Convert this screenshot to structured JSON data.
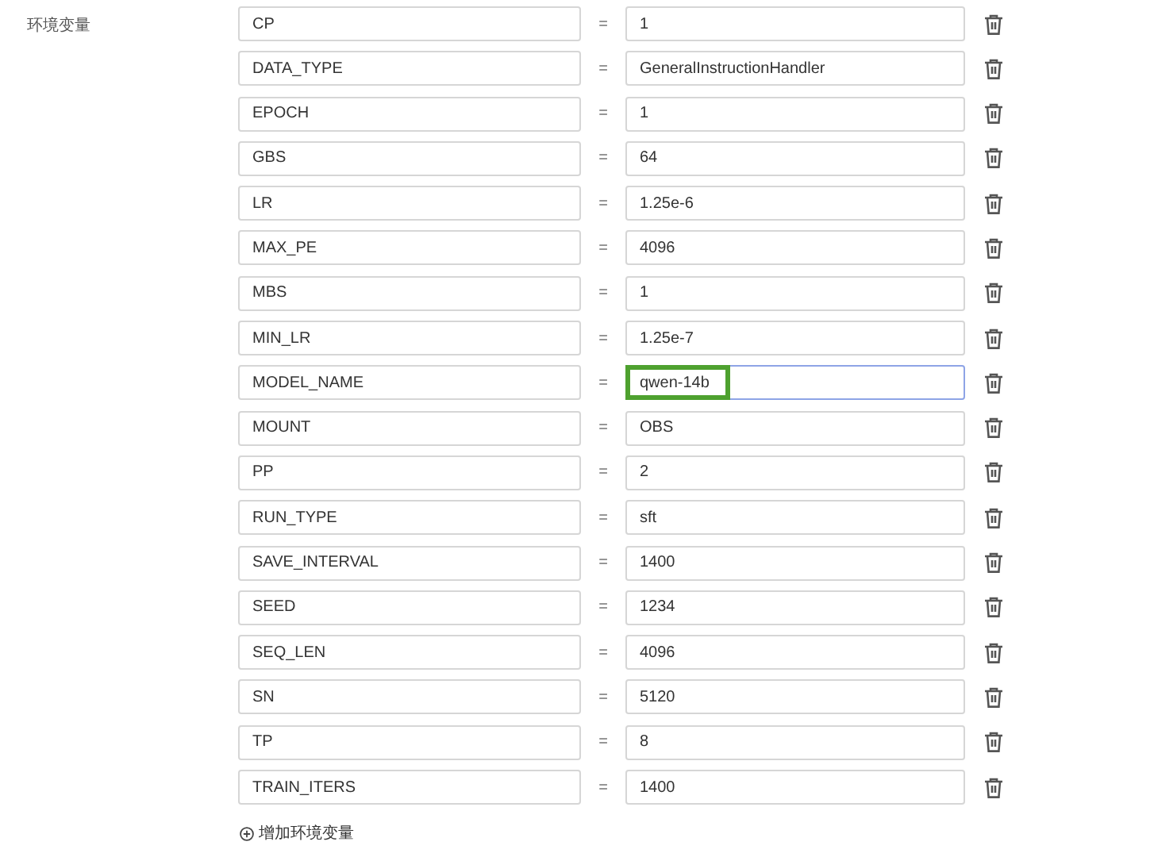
{
  "section_label": "环境变量",
  "variables": [
    {
      "key": "CP",
      "value": "1",
      "focused": false,
      "highlighted": false
    },
    {
      "key": "DATA_TYPE",
      "value": "GeneralInstructionHandler",
      "focused": false,
      "highlighted": false
    },
    {
      "key": "EPOCH",
      "value": "1",
      "focused": false,
      "highlighted": false
    },
    {
      "key": "GBS",
      "value": "64",
      "focused": false,
      "highlighted": false
    },
    {
      "key": "LR",
      "value": "1.25e-6",
      "focused": false,
      "highlighted": false
    },
    {
      "key": "MAX_PE",
      "value": "4096",
      "focused": false,
      "highlighted": false
    },
    {
      "key": "MBS",
      "value": "1",
      "focused": false,
      "highlighted": false
    },
    {
      "key": "MIN_LR",
      "value": "1.25e-7",
      "focused": false,
      "highlighted": false
    },
    {
      "key": "MODEL_NAME",
      "value": "qwen-14b",
      "focused": true,
      "highlighted": true
    },
    {
      "key": "MOUNT",
      "value": "OBS",
      "focused": false,
      "highlighted": false
    },
    {
      "key": "PP",
      "value": "2",
      "focused": false,
      "highlighted": false
    },
    {
      "key": "RUN_TYPE",
      "value": "sft",
      "focused": false,
      "highlighted": false
    },
    {
      "key": "SAVE_INTERVAL",
      "value": "1400",
      "focused": false,
      "highlighted": false
    },
    {
      "key": "SEED",
      "value": "1234",
      "focused": false,
      "highlighted": false
    },
    {
      "key": "SEQ_LEN",
      "value": "4096",
      "focused": false,
      "highlighted": false
    },
    {
      "key": "SN",
      "value": "5120",
      "focused": false,
      "highlighted": false
    },
    {
      "key": "TP",
      "value": "8",
      "focused": false,
      "highlighted": false
    },
    {
      "key": "TRAIN_ITERS",
      "value": "1400",
      "focused": false,
      "highlighted": false
    }
  ],
  "equals_sign": "=",
  "add_button": "增加环境变量"
}
